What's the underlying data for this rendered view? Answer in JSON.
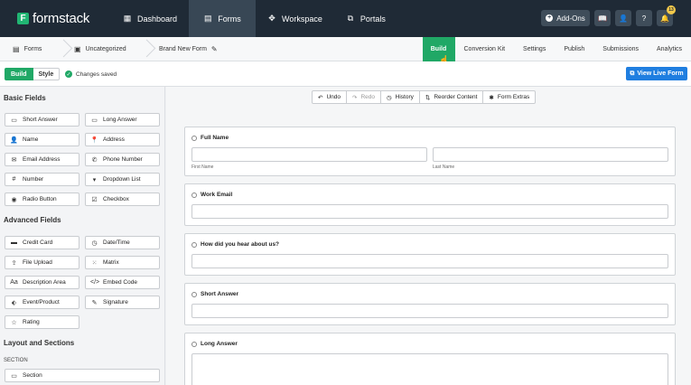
{
  "app": {
    "logo_text": "formstack"
  },
  "topnav": {
    "tabs": [
      {
        "label": "Dashboard",
        "icon": "grid-icon"
      },
      {
        "label": "Forms",
        "icon": "forms-icon"
      },
      {
        "label": "Workspace",
        "icon": "puzzle-icon"
      },
      {
        "label": "Portals",
        "icon": "portals-icon"
      }
    ],
    "addons_label": "Add-Ons",
    "notification_count": "13"
  },
  "breadcrumb": {
    "items": [
      "Forms",
      "Uncategorized",
      "Brand New Form"
    ]
  },
  "form_tabs": [
    "Build",
    "Conversion Kit",
    "Settings",
    "Publish",
    "Submissions",
    "Analytics"
  ],
  "toolbar": {
    "build_label": "Build",
    "style_label": "Style",
    "status": "Changes saved",
    "view_live_label": "View Live Form"
  },
  "canvas_toolbar": {
    "undo": "Undo",
    "redo": "Redo",
    "history": "History",
    "reorder": "Reorder Content",
    "extras": "Form Extras"
  },
  "sidebar": {
    "basic_title": "Basic Fields",
    "basic": [
      {
        "label": "Short Answer",
        "icon": "text-icon"
      },
      {
        "label": "Long Answer",
        "icon": "paragraph-icon"
      },
      {
        "label": "Name",
        "icon": "person-icon"
      },
      {
        "label": "Address",
        "icon": "pin-icon"
      },
      {
        "label": "Email Address",
        "icon": "mail-icon"
      },
      {
        "label": "Phone Number",
        "icon": "phone-icon"
      },
      {
        "label": "Number",
        "icon": "hash-icon"
      },
      {
        "label": "Dropdown List",
        "icon": "dropdown-icon"
      },
      {
        "label": "Radio Button",
        "icon": "radio-icon"
      },
      {
        "label": "Checkbox",
        "icon": "checkbox-icon"
      }
    ],
    "advanced_title": "Advanced Fields",
    "advanced": [
      {
        "label": "Credit Card",
        "icon": "card-icon"
      },
      {
        "label": "Date/Time",
        "icon": "clock-icon"
      },
      {
        "label": "File Upload",
        "icon": "upload-icon"
      },
      {
        "label": "Matrix",
        "icon": "matrix-icon"
      },
      {
        "label": "Description Area",
        "icon": "aa-icon"
      },
      {
        "label": "Embed Code",
        "icon": "code-icon"
      },
      {
        "label": "Event/Product",
        "icon": "tag-icon"
      },
      {
        "label": "Signature",
        "icon": "pen-icon"
      },
      {
        "label": "Rating",
        "icon": "star-icon"
      }
    ],
    "layout_title": "Layout and Sections",
    "section_subtitle": "SECTION",
    "section_item": {
      "label": "Section",
      "icon": "section-icon"
    }
  },
  "form_fields": [
    {
      "label": "Full Name",
      "sublabels": [
        "First Name",
        "Last Name"
      ]
    },
    {
      "label": "Work Email"
    },
    {
      "label": "How did you hear about us?"
    },
    {
      "label": "Short Answer"
    },
    {
      "label": "Long Answer"
    }
  ],
  "colors": {
    "nav_bg": "#1f2a36",
    "accent_green": "#20a866",
    "accent_blue": "#1f7ee0"
  }
}
